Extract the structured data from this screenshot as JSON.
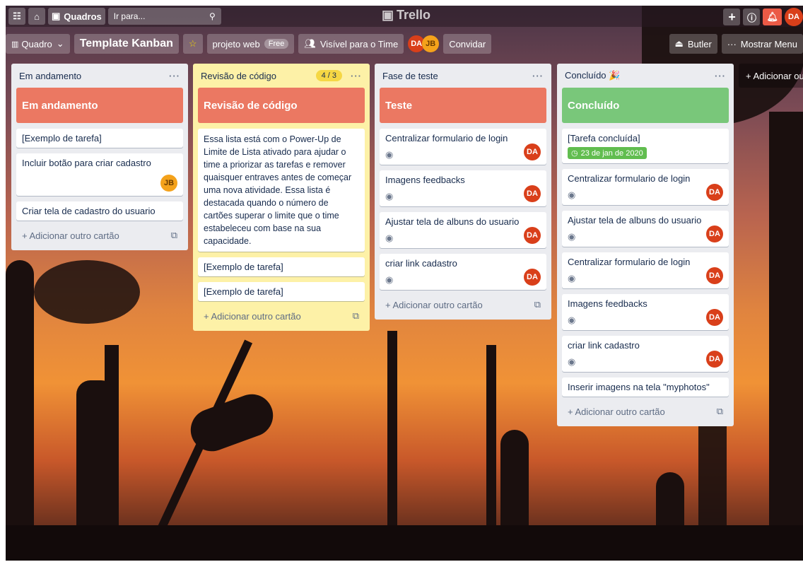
{
  "header": {
    "boards_label": "Quadros",
    "search_placeholder": "Ir para...",
    "logo": "Trello",
    "user_initials": "DA"
  },
  "board": {
    "view_label": "Quadro",
    "title": "Template Kanban",
    "team": "projeto web",
    "team_badge": "Free",
    "visibility": "Visível para o Time",
    "members": [
      "DA",
      "JB"
    ],
    "invite_label": "Convidar",
    "butler_label": "Butler",
    "menu_label": "Mostrar Menu",
    "add_list_label": "+ Adicionar outra lista"
  },
  "lists": [
    {
      "title": "Em andamento",
      "cover": "Em andamento",
      "cards": [
        {
          "text": "[Exemplo de tarefa]"
        },
        {
          "text": "Incluir botão para criar cadastro",
          "member": "JB"
        },
        {
          "text": "Criar tela de cadastro do usuario"
        }
      ],
      "add_label": "+ Adicionar outro cartão"
    },
    {
      "title": "Revisão de código",
      "limit": "4 / 3",
      "cover": "Revisão de código",
      "cards": [
        {
          "text": "Essa lista está com o Power-Up de Limite de Lista ativado para ajudar o time a priorizar as tarefas e remover quaisquer entraves antes de começar uma nova atividade. Essa lista é destacada quando o número de cartões superar o limite que o time estabeleceu com base na sua capacidade."
        },
        {
          "text": "[Exemplo de tarefa]"
        },
        {
          "text": "[Exemplo de tarefa]"
        }
      ],
      "add_label": "+ Adicionar outro cartão"
    },
    {
      "title": "Fase de teste",
      "cover": "Teste",
      "cards": [
        {
          "text": "Centralizar formulario de login",
          "member": "DA"
        },
        {
          "text": "Imagens feedbacks",
          "member": "DA"
        },
        {
          "text": "Ajustar tela de albuns do usuario",
          "member": "DA"
        },
        {
          "text": "criar link cadastro",
          "member": "DA"
        }
      ],
      "add_label": "+ Adicionar outro cartão"
    },
    {
      "title": "Concluído 🎉",
      "cover": "Concluído",
      "cards": [
        {
          "text": "[Tarefa concluída]",
          "due": "23 de jan de 2020"
        },
        {
          "text": "Centralizar formulario de login",
          "member": "DA"
        },
        {
          "text": "Ajustar tela de albuns do usuario",
          "member": "DA"
        },
        {
          "text": "Centralizar formulario de login",
          "member": "DA"
        },
        {
          "text": "Imagens feedbacks",
          "member": "DA"
        },
        {
          "text": "criar link cadastro",
          "member": "DA"
        },
        {
          "text": "Inserir imagens na tela \"myphotos\""
        }
      ],
      "add_label": "+ Adicionar outro cartão"
    }
  ]
}
